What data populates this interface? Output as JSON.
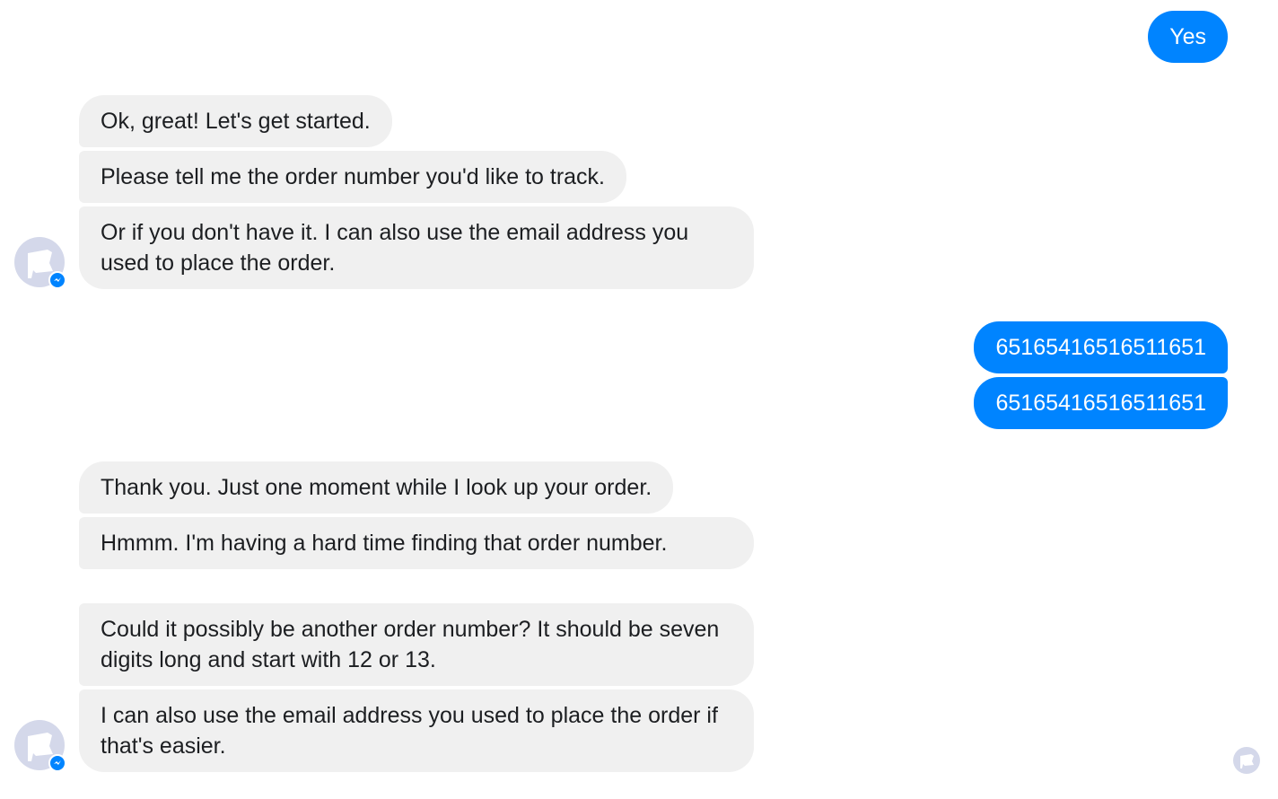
{
  "conversation": {
    "outgoing_1": "Yes",
    "bot_group_1": [
      "Ok, great! Let's get started.",
      "Please tell me the order number you'd like to track.",
      "Or if you don't have it. I can also use the email address you used to place the order."
    ],
    "outgoing_2": [
      "65165416516511651",
      "65165416516511651"
    ],
    "bot_group_2": [
      "Thank you. Just one moment while I look up your order.",
      "Hmmm. I'm having a hard time finding that order number.",
      "Could it possibly be another order number? It should be seven digits long and start with 12 or 13.",
      "I can also use the email address you used to place the order if that's easier."
    ]
  },
  "icons": {
    "bot_avatar": "white-flag-icon",
    "badge": "messenger-icon",
    "read_receipt": "seen-avatar-icon"
  },
  "colors": {
    "outgoing_bubble": "#0084ff",
    "incoming_bubble": "#f0f0f0",
    "avatar_bg": "#d4d8ea"
  }
}
